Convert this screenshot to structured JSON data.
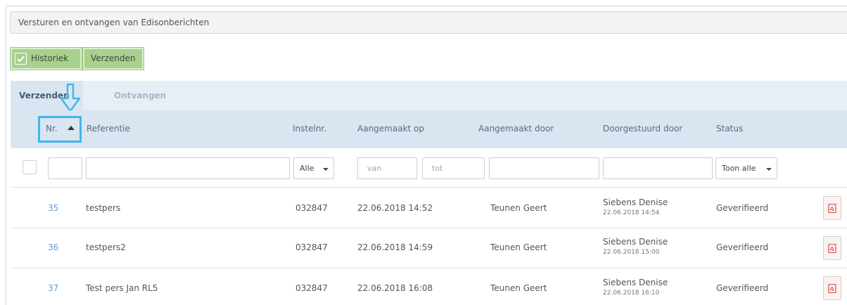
{
  "title": "Versturen en ontvangen van Edisonberichten",
  "toolbar": {
    "historiek_label": "Historiek",
    "verzenden_label": "Verzenden"
  },
  "tabs": [
    {
      "label": "Verzenden",
      "active": true
    },
    {
      "label": "Ontvangen",
      "active": false
    }
  ],
  "columns": {
    "nr": "Nr.",
    "referentie": "Referentie",
    "instelnr": "Instelnr.",
    "aangemaakt_op": "Aangemaakt op",
    "aangemaakt_door": "Aangemaakt door",
    "doorgestuurd_door": "Doorgestuurd door",
    "status": "Status"
  },
  "filters": {
    "instelnr_select": "Alle",
    "date_from_placeholder": "van",
    "date_to_placeholder": "tot",
    "status_select": "Toon alle"
  },
  "rows": [
    {
      "nr": "35",
      "referentie": "testpers",
      "instelnr": "032847",
      "aangemaakt_op": "22.06.2018 14:52",
      "aangemaakt_door": "Teunen Geert",
      "doorgestuurd_door": "Siebens Denise",
      "doorgestuurd_op": "22.06.2018 14:54",
      "status": "Geverifieerd"
    },
    {
      "nr": "36",
      "referentie": "testpers2",
      "instelnr": "032847",
      "aangemaakt_op": "22.06.2018 14:59",
      "aangemaakt_door": "Teunen Geert",
      "doorgestuurd_door": "Siebens Denise",
      "doorgestuurd_op": "22.06.2018 15:00",
      "status": "Geverifieerd"
    },
    {
      "nr": "37",
      "referentie": "Test pers Jan RL5",
      "instelnr": "032847",
      "aangemaakt_op": "22.06.2018 16:08",
      "aangemaakt_door": "Teunen Geert",
      "doorgestuurd_door": "Siebens Denise",
      "doorgestuurd_op": "22.06.2018 16:10",
      "status": "Geverifieerd"
    }
  ],
  "colors": {
    "accent_green": "#a8d18e",
    "header_blue": "#dae5f2",
    "link_blue": "#5b9bd5",
    "highlight_cyan": "#3fb7ea",
    "pdf_red": "#d9534f"
  }
}
